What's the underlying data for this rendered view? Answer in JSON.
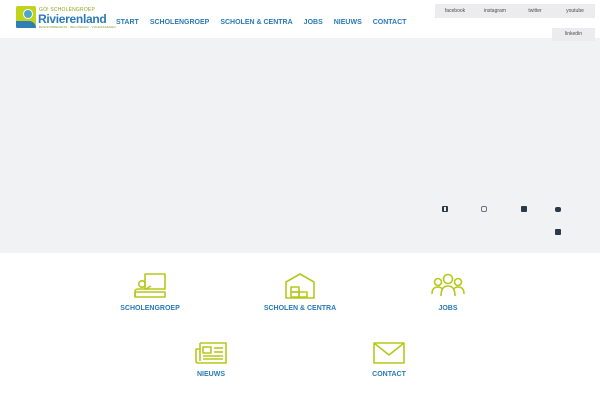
{
  "header": {
    "logo": {
      "top_line": "GO! SCHOLENGROEP",
      "name": "Rivierenland",
      "sub": "BASISONDERWIJS · SECUNDAIR · VOLWASSENEN"
    },
    "nav": [
      {
        "label": "START"
      },
      {
        "label": "SCHOLENGROEP"
      },
      {
        "label": "SCHOLEN & CENTRA"
      },
      {
        "label": "JOBS"
      },
      {
        "label": "NIEUWS"
      },
      {
        "label": "CONTACT"
      }
    ],
    "social": [
      {
        "label": "facebook"
      },
      {
        "label": "instagram"
      },
      {
        "label": "twitter"
      },
      {
        "label": "youtube"
      },
      {
        "label": "linkedin"
      }
    ]
  },
  "hero": {
    "social_icons": [
      "facebook-icon",
      "instagram-icon",
      "twitter-icon",
      "youtube-icon",
      "linkedin-icon"
    ]
  },
  "tiles": [
    {
      "label": "SCHOLENGROEP",
      "icon": "teacher-board-icon"
    },
    {
      "label": "SCHOLEN & CENTRA",
      "icon": "school-building-icon"
    },
    {
      "label": "JOBS",
      "icon": "people-group-icon"
    },
    {
      "label": "NIEUWS",
      "icon": "newspaper-icon"
    },
    {
      "label": "CONTACT",
      "icon": "envelope-icon"
    }
  ],
  "colors": {
    "accent_blue": "#2a7ab8",
    "accent_green": "#c2d31c",
    "hero_bg": "#f1f2f4"
  }
}
